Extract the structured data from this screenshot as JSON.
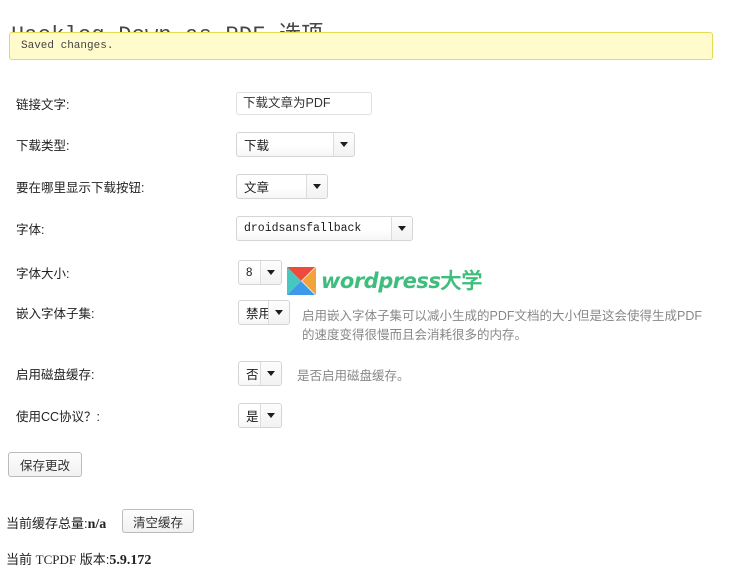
{
  "page": {
    "title": "Hacklog Down as PDF 选项"
  },
  "notice": {
    "message": "Saved changes.",
    "bg_color": "#fffbcc",
    "border_color": "#e6db55"
  },
  "form": {
    "rows": [
      {
        "label": "链接文字:",
        "control": "text",
        "value": "下载文章为PDF",
        "help": ""
      },
      {
        "label": "下载类型:",
        "control": "select",
        "value": "下载",
        "help": ""
      },
      {
        "label": "要在哪里显示下载按钮:",
        "control": "select",
        "value": "文章",
        "help": ""
      },
      {
        "label": "字体:",
        "control": "select",
        "value": "droidsansfallback",
        "help": ""
      },
      {
        "label": "字体大小:",
        "control": "select",
        "value": "8",
        "help": ""
      },
      {
        "label": "嵌入字体子集:",
        "control": "select",
        "value": "禁用",
        "help": "启用嵌入字体子集可以减小生成的PDF文档的大小但是这会使得生成PDF的速度变得很慢而且会消耗很多的内存。"
      },
      {
        "label": "启用磁盘缓存:",
        "control": "select",
        "value": "否",
        "help": "是否启用磁盘缓存。"
      },
      {
        "label": "使用CC协议？:",
        "control": "select",
        "value": "是",
        "help": ""
      }
    ]
  },
  "actions": {
    "save_label": "保存更改",
    "clear_cache_label": "清空缓存"
  },
  "footer": {
    "cache_total_label": "当前缓存总量:",
    "cache_total_value": "n/a",
    "tcpdf_version_label_prefix": "当前",
    "tcpdf_version_label_name": "TCPDF",
    "tcpdf_version_label_suffix": "版本:",
    "tcpdf_version_value": "5.9.172"
  },
  "watermark": {
    "text_latin": "wordpress",
    "text_cjk": "大学",
    "mark_colors": {
      "top": "#ec4b3e",
      "right": "#f2a33c",
      "bottom": "#3d9ae8",
      "left": "#46c8c0"
    },
    "text_color": "#3ebd7d"
  }
}
